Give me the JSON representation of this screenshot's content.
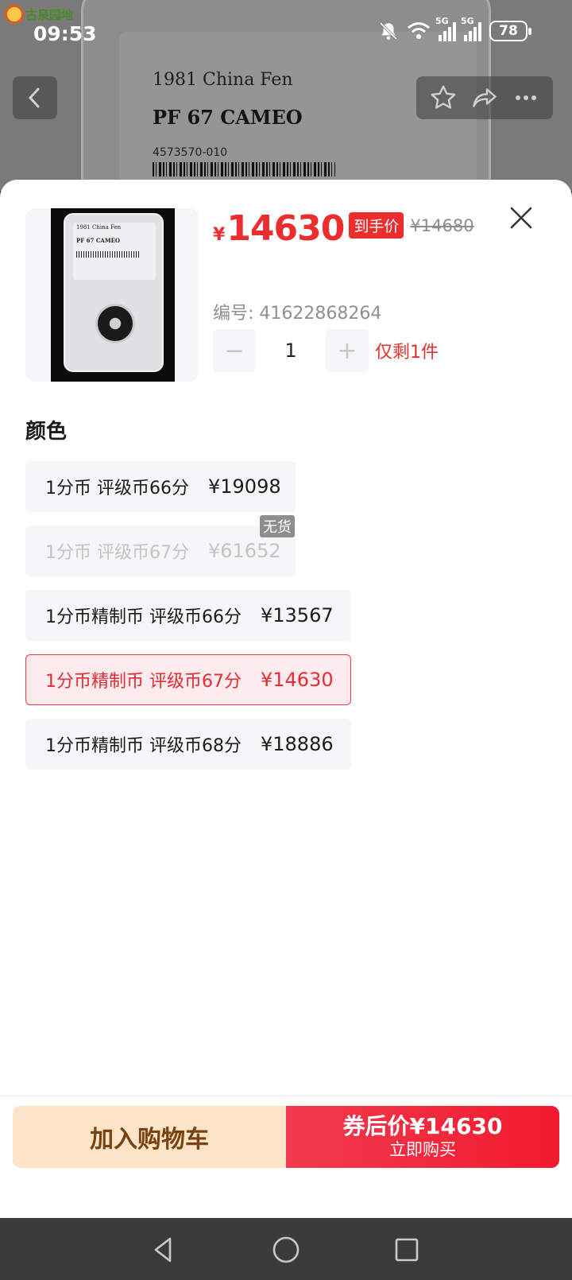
{
  "status_bar": {
    "logo_text": "古泉园地",
    "time": "09:53",
    "signal_1_label": "5G",
    "signal_2_label": "5G",
    "battery": "78"
  },
  "background_image": {
    "line1": "1981 China Fen",
    "line2": "PF 67 CAMEO",
    "line3": "4573570-010"
  },
  "thumbnail": {
    "label1": "1981 China Fen",
    "label2": "PF 67 CAMEO"
  },
  "price": {
    "currency": "¥",
    "current": "14630",
    "tag": "到手价",
    "original": "¥14680"
  },
  "code_line": "编号: 41622868264",
  "quantity": {
    "minus": "−",
    "value": "1",
    "plus": "+",
    "stock_note": "仅剩1件"
  },
  "section_title": "颜色",
  "options": [
    {
      "label": "1分币 评级币66分",
      "price": "¥19098",
      "state": "normal"
    },
    {
      "label": "1分币 评级币67分",
      "price": "¥61652",
      "state": "disabled",
      "badge": "无货"
    },
    {
      "label": "1分币精制币 评级币66分",
      "price": "¥13567",
      "state": "normal"
    },
    {
      "label": "1分币精制币 评级币67分",
      "price": "¥14630",
      "state": "selected"
    },
    {
      "label": "1分币精制币 评级币68分",
      "price": "¥18886",
      "state": "normal"
    }
  ],
  "actions": {
    "cart": "加入购物车",
    "buy_top": "券后价¥14630",
    "buy_sub": "立即购买"
  },
  "colors": {
    "accent_red": "#ec2d2d",
    "cart_bg": "#fde3c8",
    "cart_text": "#7a4210",
    "selected_bg": "#fdebee"
  }
}
